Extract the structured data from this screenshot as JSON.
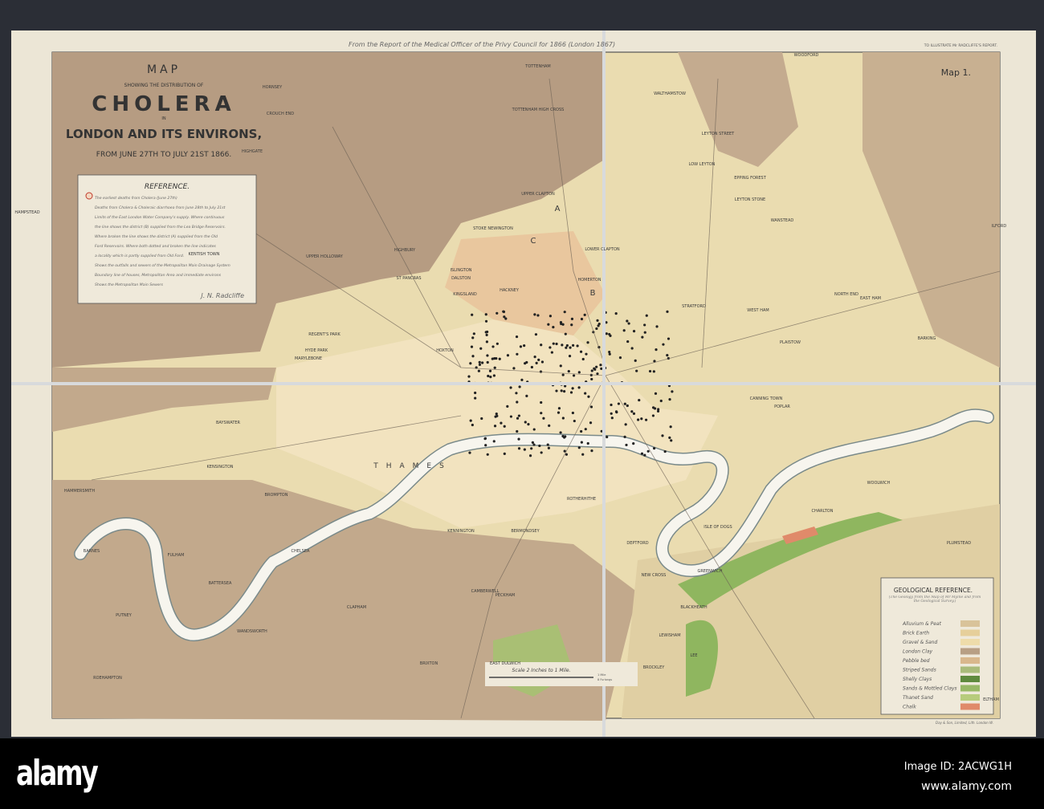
{
  "handwritten_note": "From the Report of the Medical Officer of the Privy Council for 1866 (London 1867)",
  "top_right_caption": "TO ILLUSTRATE Mr RADCLIFFE'S REPORT.",
  "map_number": "Map 1.",
  "title": {
    "line1": "MAP",
    "line2": "SHOWING THE DISTRIBUTION OF",
    "line3": "CHOLERA",
    "line4": "IN",
    "line5": "LONDON AND ITS ENVIRONS,",
    "line6": "FROM JUNE 27TH TO JULY 21ST 1866."
  },
  "reference": {
    "heading": "REFERENCE.",
    "lines": [
      "The earliest deaths from Cholera (June 27th)",
      "Deaths from Cholera & Choleraic diarrhoea from June 28th to July 21st",
      "Limits of the East London Water Company's supply. Where continuous",
      "the line shows the district (B) supplied from the Lea Bridge Reservoirs.",
      "Where broken the line shows the district (A) supplied from the Old",
      "Ford Reservoirs. Where both dotted and broken the line indicates",
      "a locality which is partly supplied from Old Ford.",
      "Shows the outfalls and sewers of the Metropolitan Main Drainage System",
      "Boundary line of houses, Metropolitan Area and immediate environs",
      "Shows the Metropolitan Main Sewers"
    ],
    "signature": "J. N. Radcliffe"
  },
  "geological_reference": {
    "heading": "GEOLOGICAL REFERENCE.",
    "subtitle": "(The Geology from the Map of Mr Mylne and from the Geological Survey.)",
    "items": [
      {
        "label": "Alluvium & Peat",
        "color": "#d9c39a"
      },
      {
        "label": "Brick Earth",
        "color": "#e6cf9a"
      },
      {
        "label": "Gravel & Sand",
        "color": "#eedcaa"
      },
      {
        "label": "London Clay",
        "color": "#b89f84"
      },
      {
        "label": "Pebble bed",
        "color": "#d9b78c"
      },
      {
        "label": "Striped Sands",
        "color": "#a9bb7a"
      },
      {
        "label": "Shelly Clays",
        "color": "#5f8a3e"
      },
      {
        "label": "Sands & Mottled Clays",
        "color": "#98b866"
      },
      {
        "label": "Thanet Sand",
        "color": "#b7cc7c"
      },
      {
        "label": "Chalk",
        "color": "#e08a6a"
      }
    ],
    "printer": "Day & Son, Limited, Lith. London W."
  },
  "scale": {
    "label": "Scale 2 Inches to 1 Mile.",
    "units": [
      "1 Mile",
      "8 Furlongs"
    ]
  },
  "places": [
    "TOTTENHAM",
    "TOTTENHAM HIGH CROSS",
    "HORNSEY",
    "CROUCH END",
    "HIGHGATE",
    "HAMPSTEAD",
    "KENTISH TOWN",
    "UPPER HOLLOWAY",
    "STOKE NEWINGTON",
    "HIGHBURY",
    "ISLINGTON",
    "ST PANCRAS",
    "KINGSLAND",
    "DALSTON",
    "HACKNEY",
    "HOMERTON",
    "UPPER CLAPTON",
    "LOWER CLAPTON",
    "WALTHAMSTOW",
    "WOODFORD",
    "EPPING FOREST",
    "LEYTON STREET",
    "LOW LEYTON",
    "LEYTON STONE",
    "WANSTEAD",
    "STRATFORD",
    "WEST HAM",
    "PLAISTOW",
    "ILFORD",
    "BARKING",
    "EAST HAM",
    "NORTH END",
    "MARYLEBONE",
    "HOXTON",
    "BAYSWATER",
    "KENSINGTON",
    "BROMPTON",
    "CHELSEA",
    "HAMMERSMITH",
    "FULHAM",
    "BARNES",
    "PUTNEY",
    "WANDSWORTH",
    "ROEHAMPTON",
    "BATTERSEA",
    "CLAPHAM",
    "BRIXTON",
    "CAMBERWELL",
    "PECKHAM",
    "KENNINGTON",
    "BERMONDSEY",
    "ROTHERHITHE",
    "DEPTFORD",
    "NEW CROSS",
    "GREENWICH",
    "ISLE OF DOGS",
    "POPLAR",
    "WOOLWICH",
    "CHARLTON",
    "BLACKHEATH",
    "LEE",
    "LEWISHAM",
    "ELTHAM",
    "PLUMSTEAD",
    "BROCKLEY",
    "EAST DULWICH",
    "CANNING TOWN",
    "THAMES",
    "REGENT'S PARK",
    "HYDE PARK",
    "A",
    "B",
    "C"
  ]
}
